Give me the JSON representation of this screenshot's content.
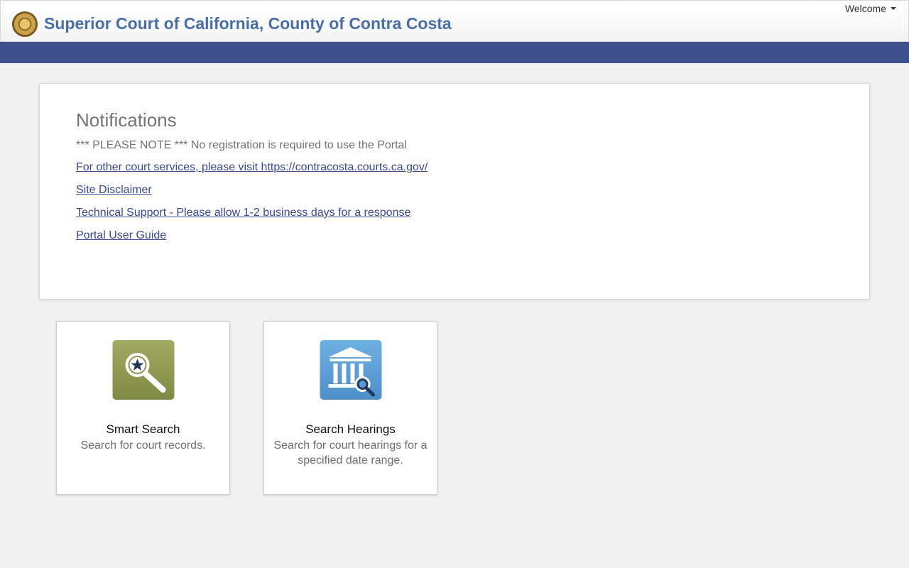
{
  "header": {
    "title": "Superior Court of California, County of Contra Costa",
    "welcome_label": "Welcome",
    "logo_icon": "california-seal-icon"
  },
  "notifications": {
    "title": "Notifications",
    "note": "*** PLEASE NOTE *** No registration is required to use the Portal",
    "links": [
      "For other court services, please visit https://contracosta.courts.ca.gov/",
      "Site Disclaimer",
      "Technical Support - Please allow 1-2 business days for a response",
      "Portal User Guide"
    ]
  },
  "tiles": [
    {
      "title": "Smart Search",
      "desc": "Search for court records.",
      "icon": "magnifier-star-icon",
      "color": "#8b964f"
    },
    {
      "title": "Search Hearings",
      "desc": "Search for court hearings for a specified date range.",
      "icon": "courthouse-search-icon",
      "color": "#5a9ad1"
    }
  ],
  "colors": {
    "brand_text": "#4a6fa5",
    "navbar": "#40508c",
    "link": "#3a4a8a",
    "background": "#f1f1f1"
  }
}
